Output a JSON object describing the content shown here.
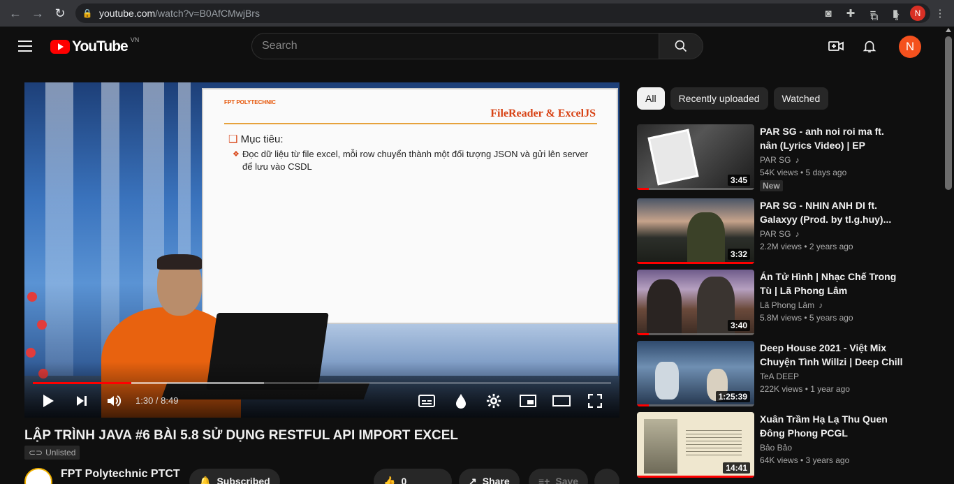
{
  "browser": {
    "url_host": "youtube.com",
    "url_path": "/watch?v=B0AfCMwjBrs",
    "profile_initial": "N"
  },
  "header": {
    "logo_text": "YouTube",
    "country_code": "VN",
    "search_placeholder": "Search",
    "avatar_initial": "N"
  },
  "player": {
    "slide": {
      "brand": "FPT POLYTECHNIC",
      "title": "FileReader & ExcelJS",
      "objective": "Mục tiêu:",
      "description": "Đọc dữ liệu từ file excel, mỗi row chuyển thành một đối tượng JSON và gửi lên server để lưu vào CSDL"
    },
    "current_time": "1:30",
    "duration": "8:49",
    "time_display": "1:30 / 8:49",
    "progress_fraction": 0.17,
    "buffer_fraction": 0.4
  },
  "video": {
    "title": "LẬP TRÌNH JAVA #6 BÀI 5.8 SỬ DỤNG RESTFUL API IMPORT EXCEL",
    "visibility": "Unlisted",
    "channel": "FPT Polytechnic PTCT",
    "subscribe_label": "Subscribed",
    "like_count": "0",
    "share_label": "Share",
    "save_label": "Save"
  },
  "sidebar": {
    "chips": [
      {
        "label": "All",
        "active": true
      },
      {
        "label": "Recently uploaded",
        "active": false
      },
      {
        "label": "Watched",
        "active": false
      }
    ],
    "recommendations": [
      {
        "title": "PAR SG - anh noi roi ma ft. nân (Lyrics Video) | EP \"LOVE\"",
        "channel": "PAR SG",
        "meta": "54K views • 5 days ago",
        "duration": "3:45",
        "badge": "New",
        "watched_fraction": 0.1
      },
      {
        "title": "PAR SG - NHIN ANH DI ft. Galaxyy (Prod. by tl.g.huy)...",
        "channel": "PAR SG",
        "meta": "2.2M views • 2 years ago",
        "duration": "3:32",
        "watched_fraction": 1.0
      },
      {
        "title": "Án Tử Hình | Nhạc Chế Trong Tù | Lã Phong Lâm",
        "channel": "Lã Phong Lâm",
        "meta": "5.8M views • 5 years ago",
        "duration": "3:40",
        "watched_fraction": 0.1
      },
      {
        "title": "Deep House 2021 - Việt Mix Chuyện Tình Willzi | Deep Chill",
        "channel": "TeA DEEP",
        "meta": "222K views • 1 year ago",
        "duration": "1:25:39",
        "watched_fraction": 0.1
      },
      {
        "title": "Xuân Trầm Hạ Lạ Thu Quen Đông Phong PCGL",
        "channel": "Bảo Bảo",
        "meta": "64K views • 3 years ago",
        "duration": "14:41",
        "watched_fraction": 1.0
      }
    ]
  }
}
